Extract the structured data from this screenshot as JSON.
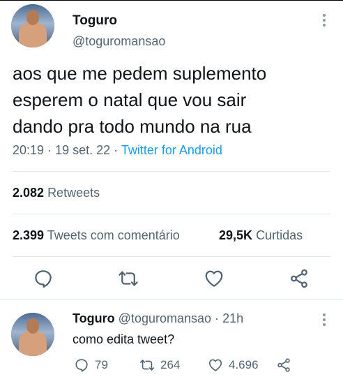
{
  "tweet": {
    "name": "Toguro",
    "handle": "@toguromansao",
    "text_lines": [
      "aos que me pedem suplemento",
      "esperem o natal que vou sair",
      "dando pra todo mundo na rua"
    ],
    "time": "20:19",
    "date": "19 set. 22",
    "source": "Twitter for Android",
    "sep": "·"
  },
  "stats": {
    "retweets_count": "2.082",
    "retweets_label": "Retweets",
    "quotes_count": "2.399",
    "quotes_label": "Tweets com comentário",
    "likes_count": "29,5K",
    "likes_label": "Curtidas"
  },
  "actions": [
    "reply-icon",
    "retweet-icon",
    "like-icon",
    "share-icon"
  ],
  "reply": {
    "name": "Toguro",
    "handle": "@toguromansao",
    "sep": "·",
    "age": "21h",
    "text": "como edita tweet?",
    "replies": "79",
    "retweets": "264",
    "likes": "4.696"
  },
  "colors": {
    "accent": "#1d9bf0",
    "muted": "#536471",
    "text": "#0f1419",
    "divider": "#e1e6ea"
  }
}
